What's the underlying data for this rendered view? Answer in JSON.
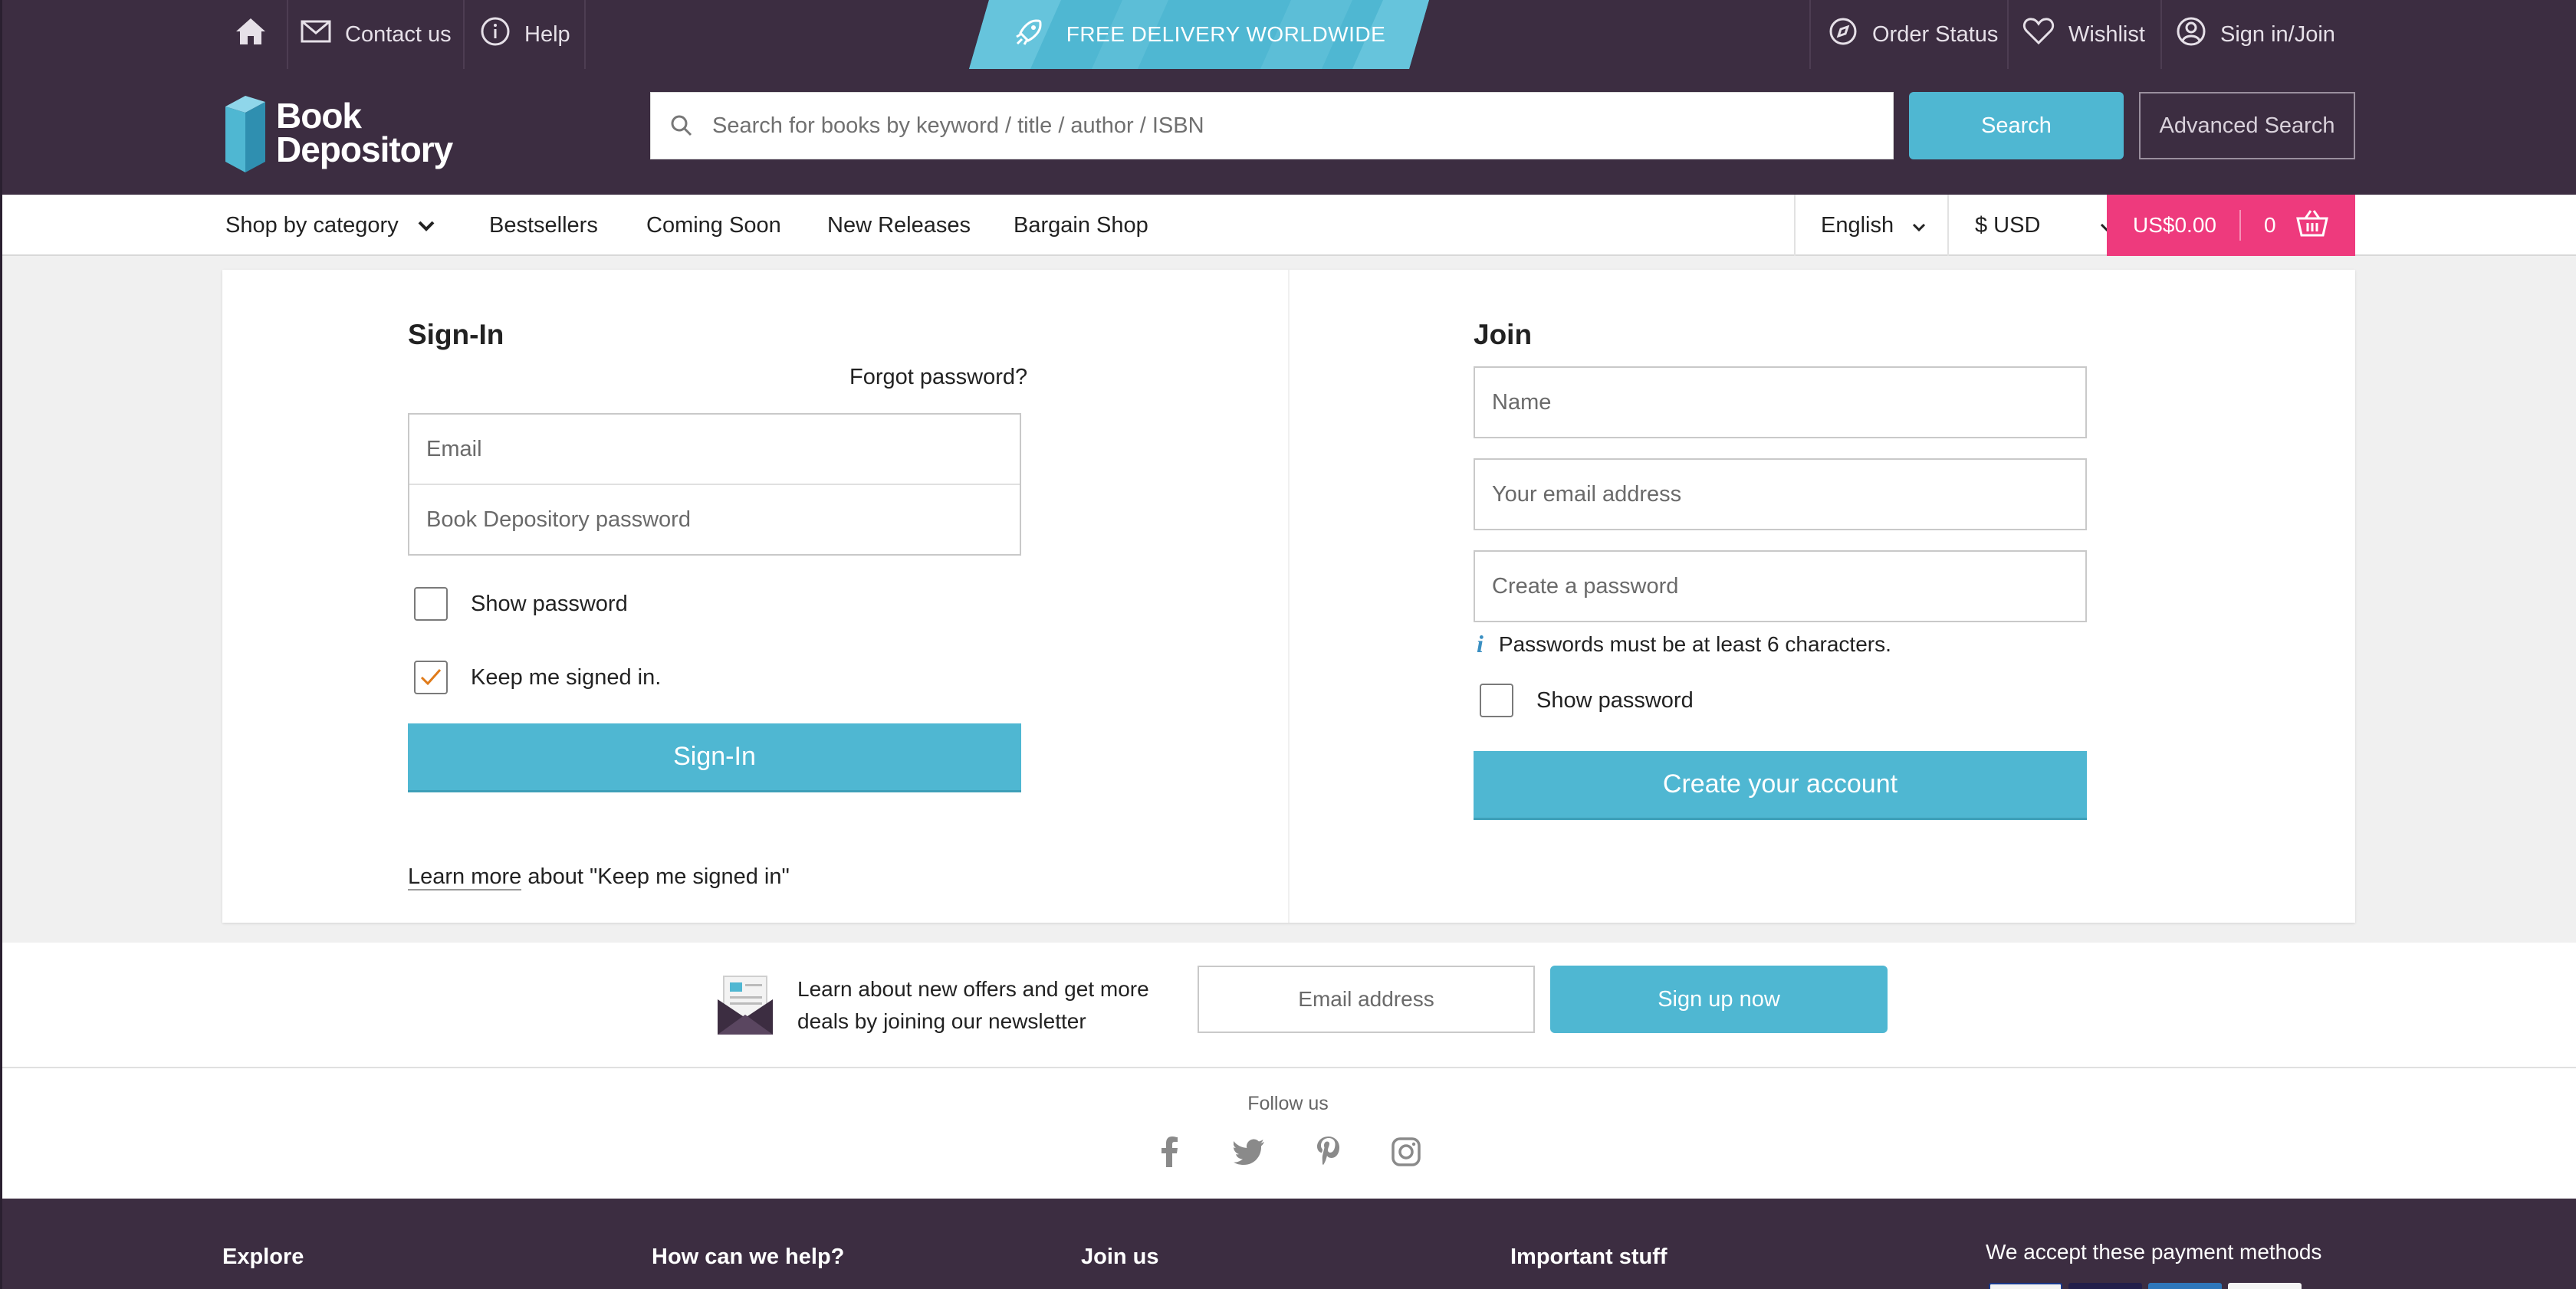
{
  "topbar": {
    "contact_label": "Contact us",
    "help_label": "Help",
    "promo_text": "FREE DELIVERY WORLDWIDE",
    "order_status_label": "Order Status",
    "wishlist_label": "Wishlist",
    "signin_label": "Sign in/Join"
  },
  "header": {
    "logo_line1": "Book",
    "logo_line2": "Depository",
    "search_placeholder": "Search for books by keyword / title / author / ISBN",
    "search_button": "Search",
    "advanced_search_button": "Advanced Search"
  },
  "nav": {
    "shop_by_category": "Shop by category",
    "items": [
      "Bestsellers",
      "Coming Soon",
      "New Releases",
      "Bargain Shop"
    ],
    "language": "English",
    "currency": "$ USD",
    "basket_total": "US$0.00",
    "basket_count": "0"
  },
  "signin": {
    "title": "Sign-In",
    "forgot_password": "Forgot password?",
    "email_placeholder": "Email",
    "password_placeholder": "Book Depository password",
    "show_password": "Show password",
    "keep_signed_in": "Keep me signed in.",
    "keep_signed_in_checked": true,
    "show_password_checked": false,
    "button": "Sign-In",
    "learn_more_link": "Learn more",
    "learn_more_rest": " about \"Keep me signed in\""
  },
  "join": {
    "title": "Join",
    "name_placeholder": "Name",
    "email_placeholder": "Your email address",
    "password_placeholder": "Create a password",
    "password_hint": "Passwords must be at least 6 characters.",
    "show_password": "Show password",
    "show_password_checked": false,
    "button": "Create your account"
  },
  "newsletter": {
    "text": "Learn about new offers and get more deals by joining our newsletter",
    "email_placeholder": "Email address",
    "button": "Sign up now"
  },
  "follow": {
    "label": "Follow us",
    "icons": [
      "facebook-icon",
      "twitter-icon",
      "pinterest-icon",
      "instagram-icon"
    ]
  },
  "footer": {
    "headings": [
      "Explore",
      "How can we help?",
      "Join us",
      "Important stuff"
    ],
    "payment_heading": "We accept these payment methods"
  },
  "colors": {
    "brand_dark": "#3c2d41",
    "accent_blue": "#4fb7d2",
    "basket_pink": "#ee3a7d",
    "checkmark_orange": "#e07b1a"
  }
}
